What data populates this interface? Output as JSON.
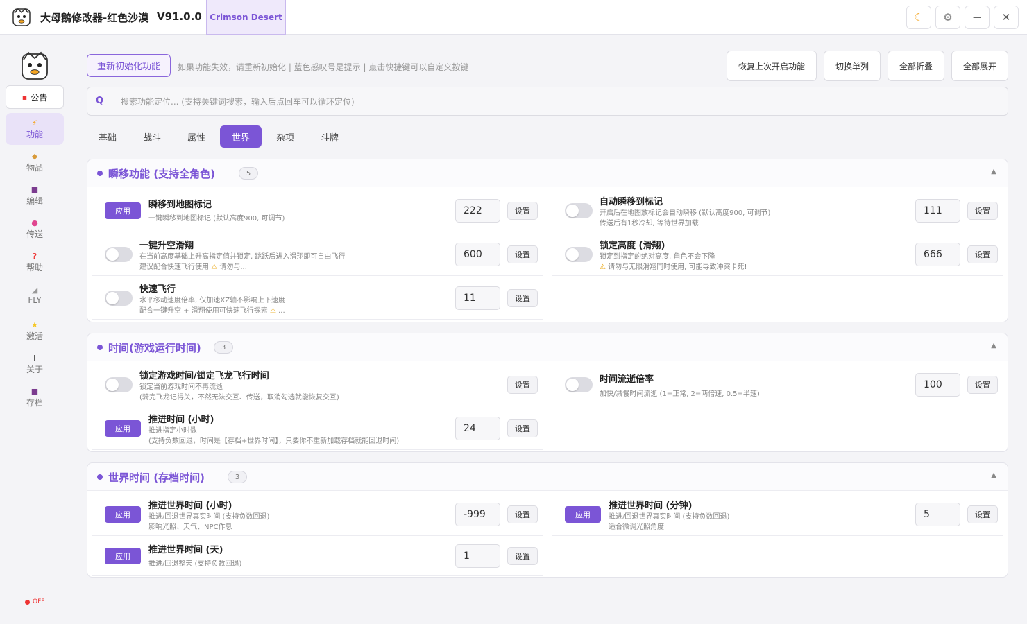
{
  "titlebar": {
    "title": "大母鹅修改器-红色沙漠",
    "version": "V91.0.0",
    "game_tab": "Crimson Desert",
    "moon_icon": "☾",
    "gear_icon": "⚙",
    "minimize_icon": "—",
    "close_icon": "✕"
  },
  "sidebar": {
    "notice_label": "公告",
    "notice_icon": "▪",
    "items": [
      {
        "label": "功能",
        "icon": "⚡"
      },
      {
        "label": "物品",
        "icon": "◆"
      },
      {
        "label": "编辑",
        "icon": "■"
      },
      {
        "label": "传送",
        "icon": "●"
      },
      {
        "label": "帮助",
        "icon": "?"
      },
      {
        "label": "FLY",
        "icon": "◢"
      },
      {
        "label": "激活",
        "icon": "★"
      },
      {
        "label": "关于",
        "icon": "i"
      },
      {
        "label": "存档",
        "icon": "■"
      }
    ],
    "status": "OFF"
  },
  "toolbar": {
    "reinit_label": "重新初始化功能",
    "hint": "如果功能失效，请重新初始化 | 蓝色感叹号是提示 | 点击快捷键可以自定义按键",
    "buttons": [
      "恢复上次开启功能",
      "切换单列",
      "全部折叠",
      "全部展开"
    ]
  },
  "search": {
    "q": "Q",
    "placeholder": "搜索功能定位... (支持关键词搜索，输入后点回车可以循环定位)"
  },
  "tabs": [
    "基础",
    "战斗",
    "属性",
    "世界",
    "杂项",
    "斗牌"
  ],
  "common": {
    "apply": "应用",
    "set": "设置",
    "warn": "⚠",
    "collapse": "▲"
  },
  "sections": [
    {
      "title": "瞬移功能 (支持全角色)",
      "count": "5",
      "rows": [
        {
          "title": "瞬移到地图标记",
          "desc1": "一键瞬移到地图标记 (默认高度900, 可调节)",
          "value": "222"
        },
        {
          "title": "自动瞬移到标记",
          "desc1": "开启后在地图放标记会自动瞬移 (默认高度900, 可调节)",
          "desc2": "传送后有1秒冷却, 等待世界加载",
          "value": "111"
        },
        {
          "title": "一键升空滑翔",
          "desc1": "在当前高度基础上升高指定值并锁定, 跳跃后进入滑翔即可自由飞行",
          "desc2": "建议配合快速飞行使用",
          "desc2_tail": "请勿与...",
          "value": "600"
        },
        {
          "title": "锁定高度 (滑翔)",
          "desc1": "锁定到指定的绝对高度, 角色不会下降",
          "desc2": "请勿与无限滑翔同时使用, 可能导致冲突卡死!",
          "value": "666"
        },
        {
          "title": "快速飞行",
          "desc1": "水平移动速度倍率, 仅加速XZ轴不影响上下速度",
          "desc2": "配合一键升空 + 滑翔使用可快速飞行探索",
          "desc2_tail": "...",
          "value": "11"
        }
      ]
    },
    {
      "title": "时间(游戏运行时间)",
      "count": "3",
      "rows": [
        {
          "title": "锁定游戏时间/锁定飞龙飞行时间",
          "desc1": "锁定当前游戏时间不再流逝",
          "desc2": "(骑完飞龙记得关，不然无法交互、传送，取消勾选就能恢复交互)"
        },
        {
          "title": "时间流逝倍率",
          "desc1": "加快/减慢时间流逝 (1=正常, 2=两倍速, 0.5=半速)",
          "value": "100"
        },
        {
          "title": "推进时间 (小时)",
          "desc1": "推进指定小时数",
          "desc2": "(支持负数回退，时间是【存档+世界时间】，只要你不重新加载存档就能回退时间)",
          "value": "24"
        }
      ]
    },
    {
      "title": "世界时间 (存档时间)",
      "count": "3",
      "rows": [
        {
          "title": "推进世界时间 (小时)",
          "desc1": "推进/回退世界真实时间 (支持负数回退)",
          "desc2": "影响光照、天气、NPC作息",
          "value": "-999"
        },
        {
          "title": "推进世界时间 (分钟)",
          "desc1": "推进/回退世界真实时间 (支持负数回退)",
          "desc2": "适合微调光照角度",
          "value": "5"
        },
        {
          "title": "推进世界时间 (天)",
          "desc1": "推进/回退整天 (支持负数回退)",
          "value": "1"
        }
      ]
    }
  ]
}
